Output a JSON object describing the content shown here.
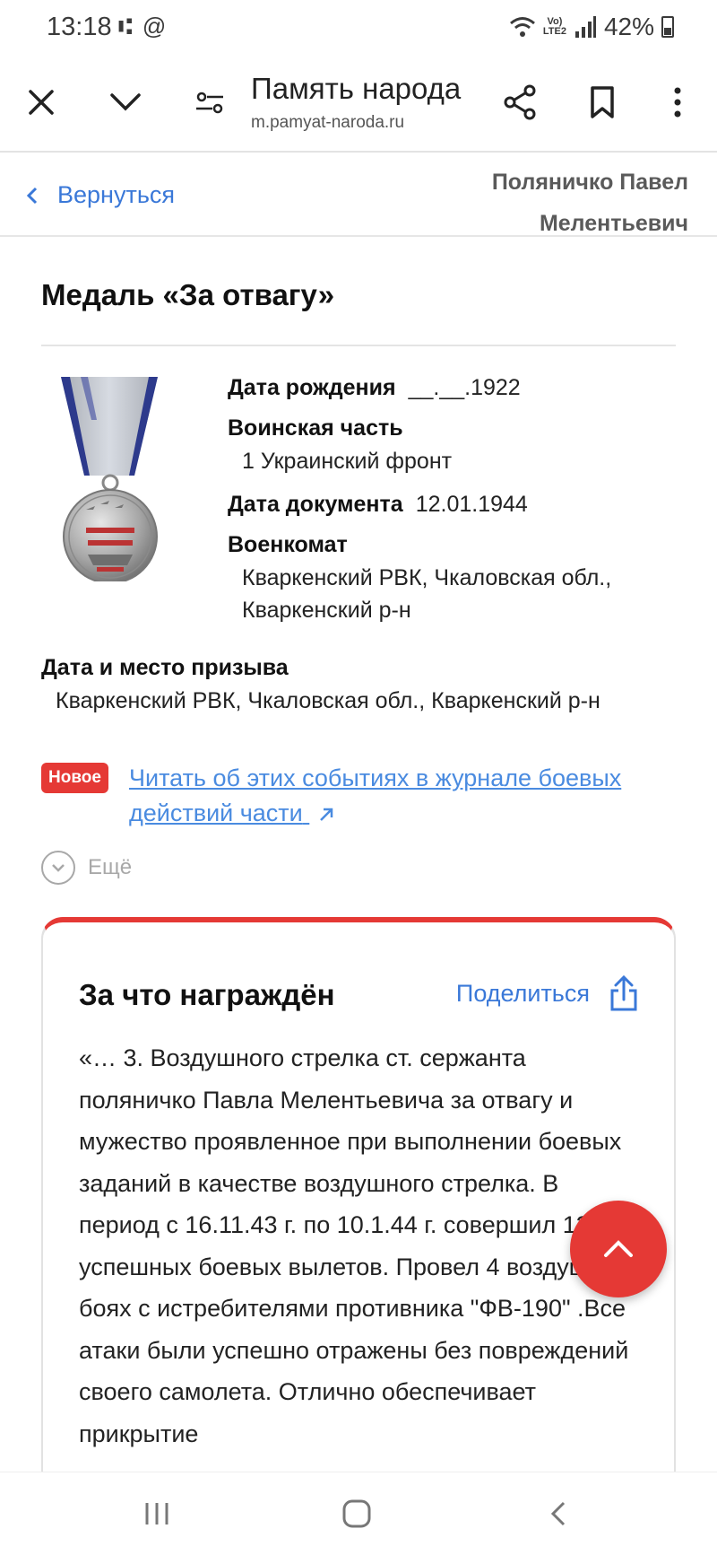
{
  "status_bar": {
    "time": "13:18",
    "left_icons": "⑆ @",
    "battery": "42%",
    "network": "Vo)\nLTE2"
  },
  "browser": {
    "title": "Память народа",
    "url": "m.pamyat-naroda.ru",
    "icons": [
      "close-icon",
      "chevron-down-icon",
      "page-settings-icon",
      "share-icon",
      "bookmark-icon",
      "more-icon"
    ]
  },
  "back_bar": {
    "back_label": "Вернуться",
    "person_name": "Поляничко Павел Мелентьевич"
  },
  "award": {
    "title": "Медаль «За отвагу»",
    "facts": [
      {
        "label": "Дата рождения",
        "value": "__.__.1922"
      },
      {
        "label": "Воинская часть",
        "value": "1 Украинский фронт"
      },
      {
        "label": "Дата документа",
        "value": "12.01.1944"
      },
      {
        "label": "Военкомат",
        "value": "Кваркенский РВК, Чкаловская обл., Кваркенский р-н"
      }
    ],
    "conscription": {
      "label": "Дата и место призыва",
      "value": "Кваркенский РВК, Чкаловская обл., Кваркенский р-н"
    },
    "new_badge": "Новое",
    "journal_link": "Читать об этих событиях в журнале боевых действий части",
    "more_label": "Ещё"
  },
  "reason_card": {
    "title": "За что награждён",
    "share_label": "Поделиться",
    "text": "«… 3. Воздушного стрелка ст. сержанта поляничко Павла Мелентьевича за отвагу и мужество проявленное при выполнении боевых заданий в качестве воздушного стрелка. В период с 16.11.43 г. по 10.1.44 г. совершил 13 успешных боевых вылетов. Провел 4 воздушных боях с истребителями противника \"ФВ-190\" .Все атаки были успешно отражены без повреждений своего самолета. Отлично обеспечивает прикрытие"
  },
  "colors": {
    "accent_red": "#e53935",
    "link_blue": "#3a78d8"
  }
}
